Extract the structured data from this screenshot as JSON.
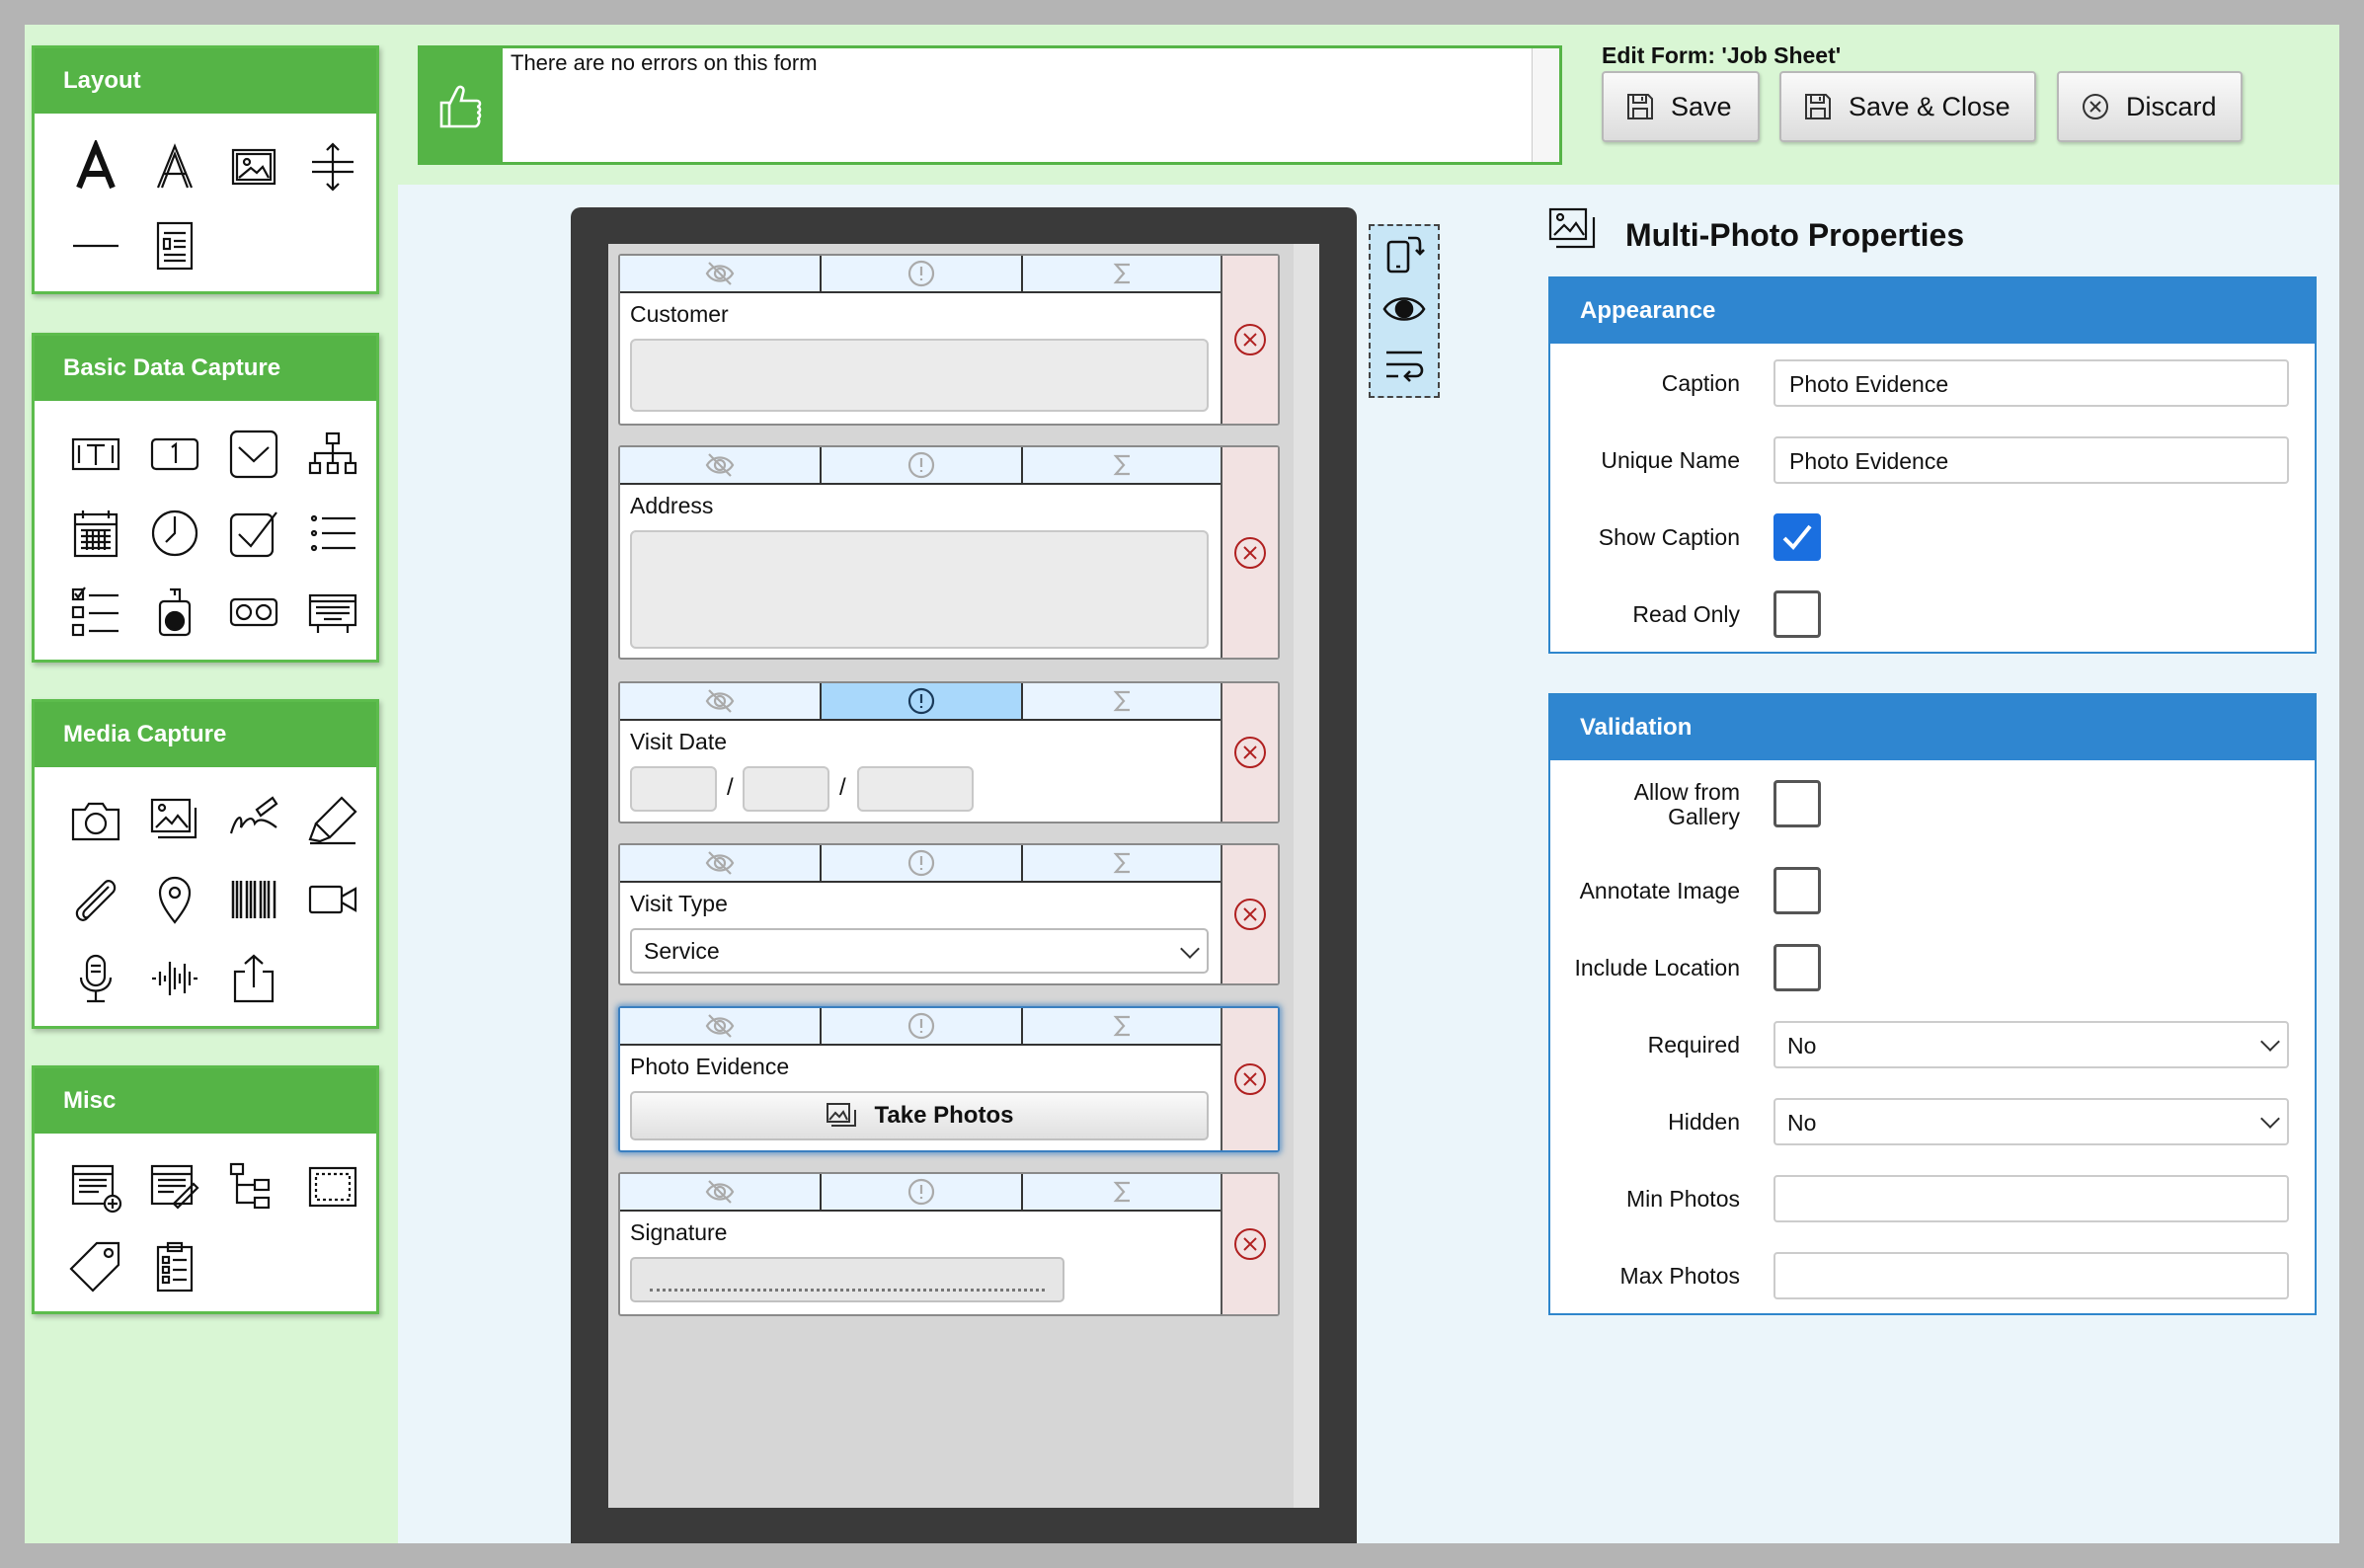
{
  "palette": {
    "layout": {
      "title": "Layout",
      "icons": [
        "text-bold-icon",
        "text-outline-icon",
        "image-icon",
        "spacer-icon",
        "divider-icon",
        "document-icon"
      ]
    },
    "basic": {
      "title": "Basic Data Capture",
      "icons": [
        "text-field-icon",
        "number-field-icon",
        "dropdown-icon",
        "hierarchy-icon",
        "calendar-icon",
        "clock-icon",
        "checkbox-icon",
        "list-icon",
        "checklist-icon",
        "dial-icon",
        "toggle-icon",
        "keyboard-icon"
      ]
    },
    "media": {
      "title": "Media Capture",
      "icons": [
        "camera-icon",
        "multi-photo-icon",
        "signature-icon",
        "highlighter-icon",
        "paperclip-icon",
        "location-pin-icon",
        "barcode-icon",
        "video-icon",
        "microphone-icon",
        "audio-wave-icon",
        "upload-icon"
      ]
    },
    "misc": {
      "title": "Misc",
      "icons": [
        "add-form-icon",
        "edit-form-icon",
        "tree-icon",
        "frame-icon",
        "tag-icon",
        "clipboard-icon"
      ]
    }
  },
  "message": {
    "text": "There are no errors on this form",
    "icon": "thumbs-up-icon"
  },
  "header": {
    "title": "Edit Form: 'Job Sheet'",
    "save": "Save",
    "save_close": "Save & Close",
    "discard": "Discard"
  },
  "form_fields": [
    {
      "label": "Customer"
    },
    {
      "label": "Address"
    },
    {
      "label": "Visit Date",
      "date_separator": "/"
    },
    {
      "label": "Visit Type",
      "value": "Service"
    },
    {
      "label": "Photo Evidence",
      "button": "Take Photos"
    },
    {
      "label": "Signature"
    }
  ],
  "properties": {
    "title": "Multi-Photo Properties",
    "appearance": {
      "title": "Appearance",
      "caption_label": "Caption",
      "caption_value": "Photo Evidence",
      "unique_label": "Unique Name",
      "unique_value": "Photo Evidence",
      "show_caption_label": "Show Caption",
      "show_caption": true,
      "read_only_label": "Read Only",
      "read_only": false
    },
    "validation": {
      "title": "Validation",
      "gallery_label_1": "Allow from",
      "gallery_label_2": "Gallery",
      "allow_gallery": false,
      "annotate_label": "Annotate Image",
      "annotate": false,
      "location_label": "Include Location",
      "location": false,
      "required_label": "Required",
      "required_value": "No",
      "hidden_label": "Hidden",
      "hidden_value": "No",
      "min_label": "Min Photos",
      "min_value": "",
      "max_label": "Max Photos",
      "max_value": ""
    }
  },
  "colors": {
    "green": "#55b446",
    "blue": "#2f86d0",
    "highlight": "#a9d8fb"
  }
}
